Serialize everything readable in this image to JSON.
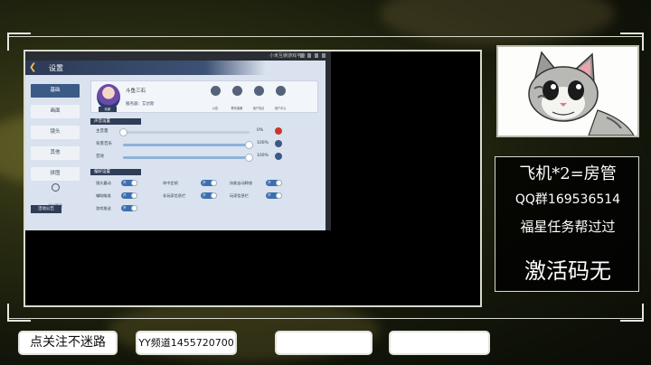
{
  "game": {
    "emulator_title": "小米互娱游戏平台",
    "header_title": "设置",
    "menu": [
      "基础",
      "画面",
      "镜头",
      "其他",
      "拼图"
    ],
    "logout_label": "退出登录",
    "announce_label": "活动公告",
    "player_name": "斗鱼三石",
    "avatar_tag": "玩家",
    "server_text": "服务器：艾达斯",
    "actions": [
      "公告",
      "联系客服",
      "用户协议",
      "用户中心"
    ],
    "sound_section": "声音设置",
    "sliders": [
      {
        "label": "主音量",
        "percent": "0%",
        "value": 0,
        "muted": true
      },
      {
        "label": "背景音乐",
        "percent": "100%",
        "value": 100,
        "muted": false
      },
      {
        "label": "音效",
        "percent": "100%",
        "value": 100,
        "muted": false
      }
    ],
    "pref_section": "偏好设置",
    "toggle_on_label": "开",
    "toggles": [
      {
        "label": "镜头震动"
      },
      {
        "label": "命中定帧"
      },
      {
        "label": "技能自动释放"
      },
      {
        "label": "辅助瞄准"
      },
      {
        "label": "非玩家信息栏"
      },
      {
        "label": "玩家信息栏"
      },
      {
        "label": "游戏推送"
      }
    ]
  },
  "right_panel": {
    "line1": "飞机*2=房管",
    "line2": "QQ群169536514",
    "line3": "福星任务帮过过",
    "line4": "激活码无"
  },
  "bottom": {
    "follow": "点关注不迷路",
    "yy": "YY频道1455720700",
    "blank1": "",
    "blank2": ""
  }
}
